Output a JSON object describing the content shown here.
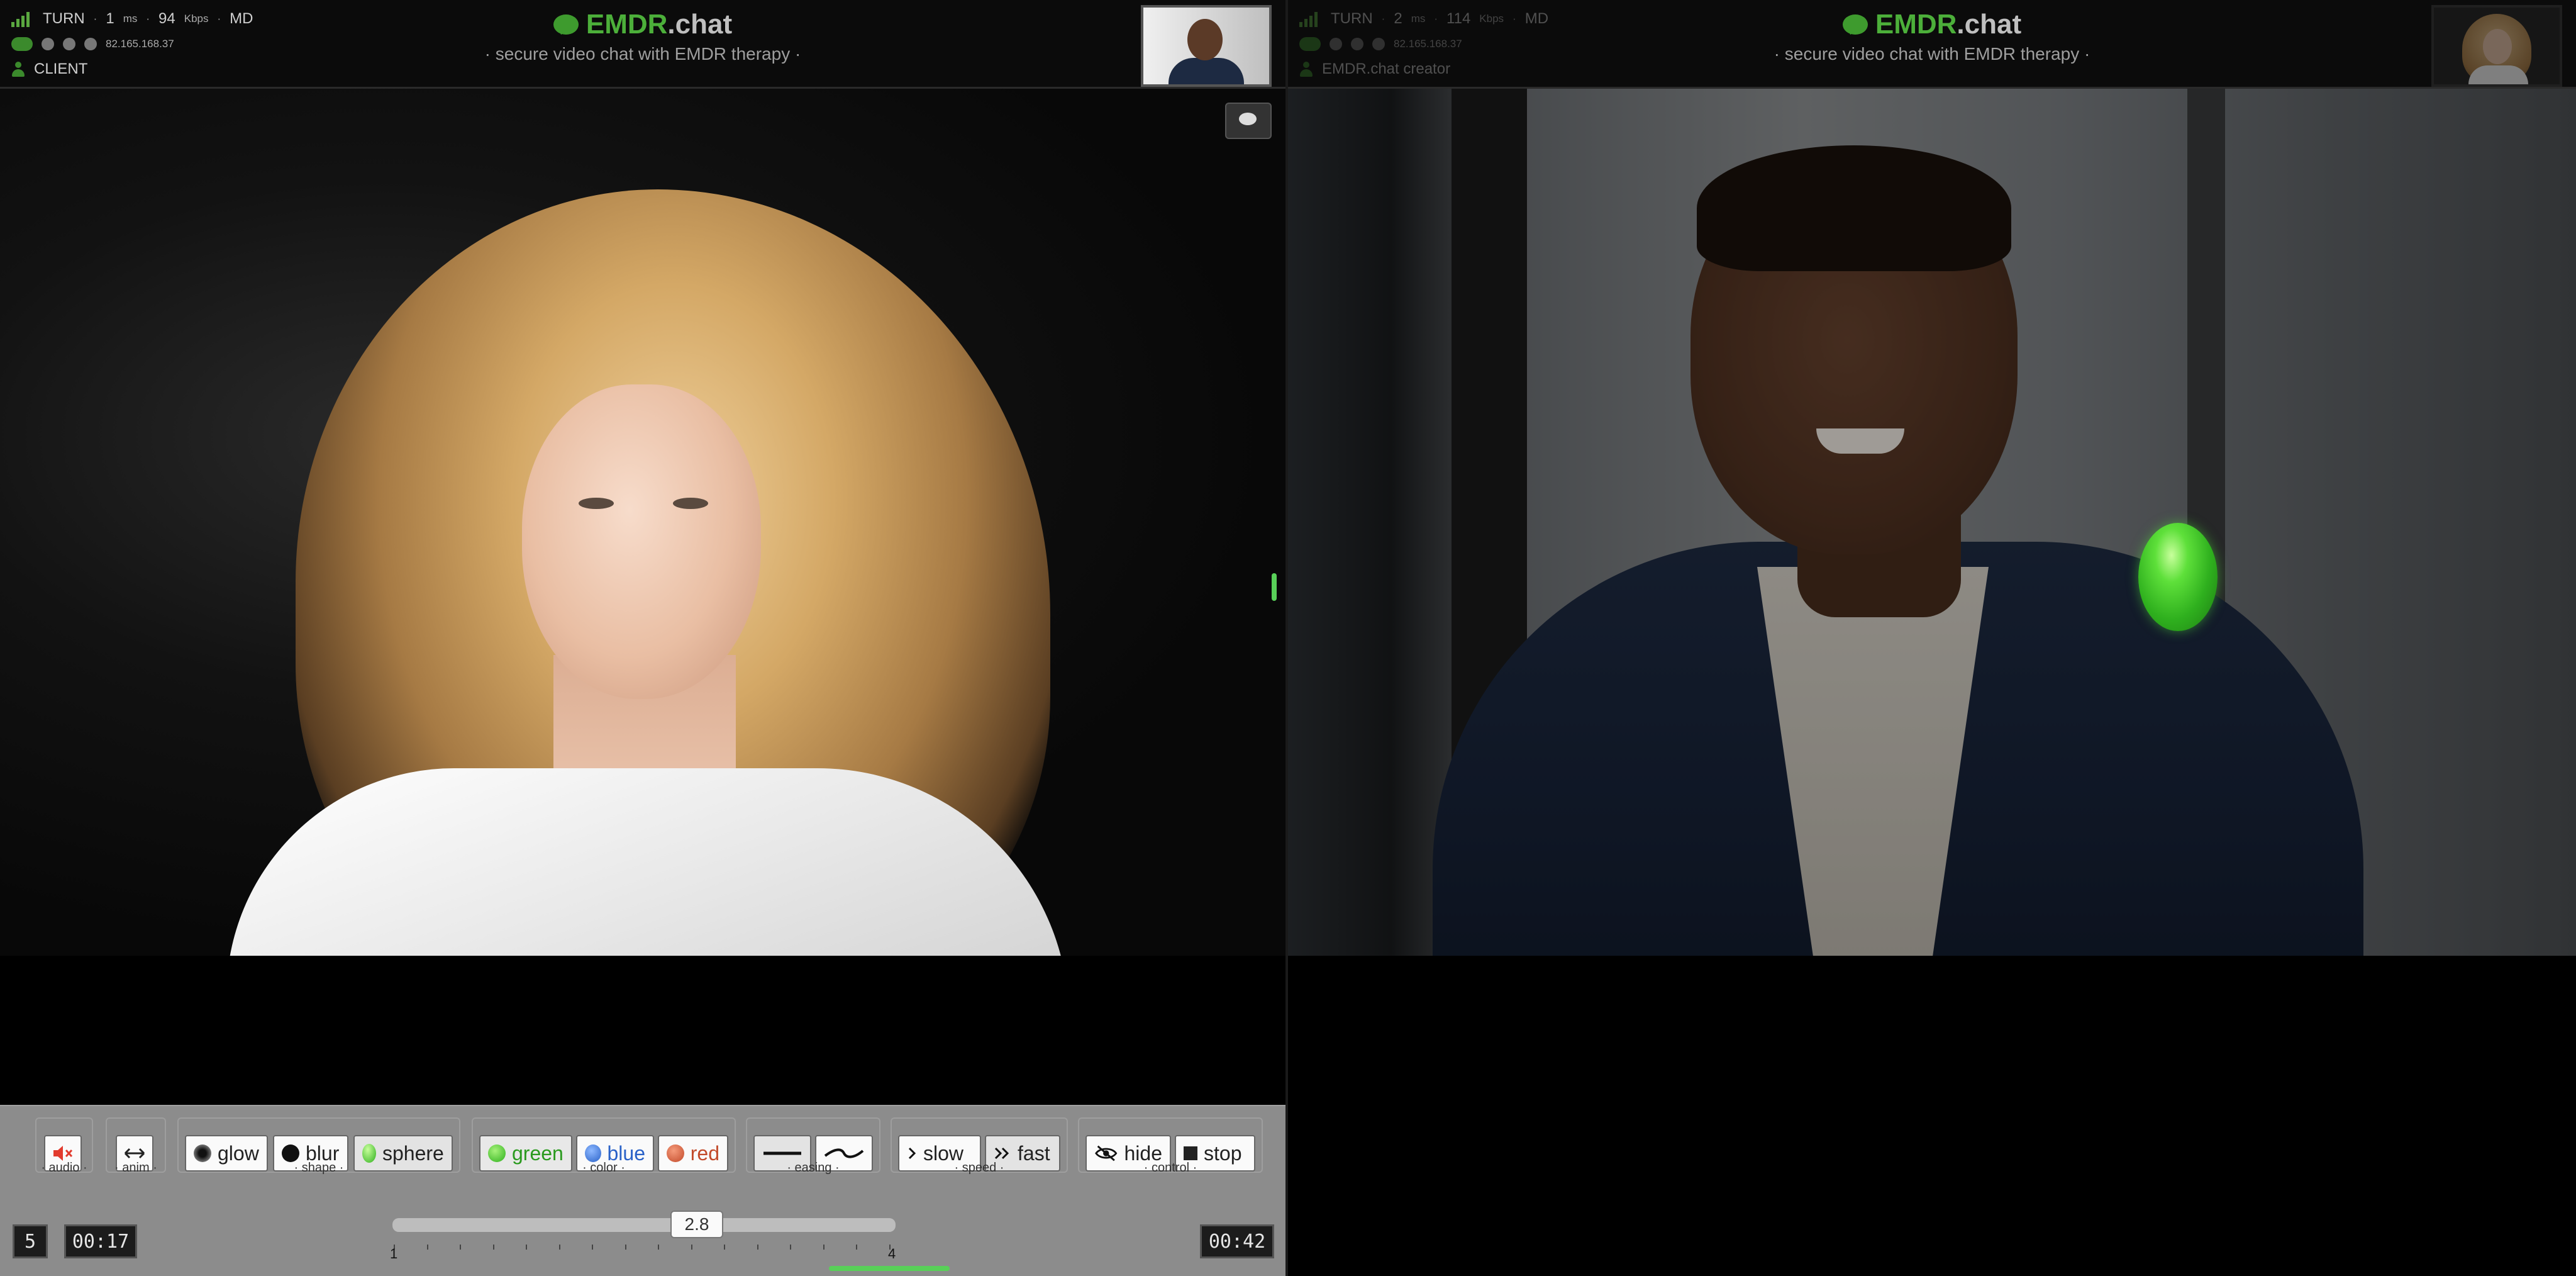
{
  "brand": {
    "name_main": "EMDR",
    "name_tld": ".chat",
    "subtitle": "· secure video chat with EMDR therapy ·"
  },
  "left_status": {
    "connection": "TURN",
    "latency": "1",
    "latency_unit": "ms",
    "bitrate": "94",
    "bitrate_unit": "Kbps",
    "region": "MD",
    "ip": "82.165.168.37",
    "role": "CLIENT"
  },
  "right_status": {
    "connection": "TURN",
    "latency": "2",
    "latency_unit": "ms",
    "bitrate": "114",
    "bitrate_unit": "Kbps",
    "region": "MD",
    "ip": "82.165.168.37",
    "role": "EMDR.chat creator"
  },
  "controls": {
    "audio": {
      "label": "· audio ·"
    },
    "anim": {
      "label": "· anim ·"
    },
    "shape": {
      "label": "· shape ·",
      "glow": "glow",
      "blur": "blur",
      "sphere": "sphere"
    },
    "color": {
      "label": "· color ·",
      "green": "green",
      "blue": "blue",
      "red": "red"
    },
    "easing": {
      "label": "· easing ·"
    },
    "speed": {
      "label": "· speed ·",
      "slow": "slow",
      "fast": "fast"
    },
    "control": {
      "label": "· control ·",
      "hide": "hide",
      "stop": "stop"
    }
  },
  "session": {
    "count": "5",
    "elapsed": "00:17",
    "remaining": "00:42"
  },
  "slider": {
    "value": "2.8",
    "min_label": "1",
    "max_label": "4"
  },
  "colors": {
    "accent_green": "#4caf3a",
    "orb_green": "#2fb01e",
    "color_blue": "#2a62c8",
    "color_red": "#c24a2a"
  },
  "icons": [
    "signal-bars-icon",
    "cloud-icon",
    "person-icon",
    "chat-icon",
    "muted-speaker-icon",
    "left-right-arrow-icon",
    "glow-dot-icon",
    "blur-dot-icon",
    "sphere-icon",
    "line-easing-icon",
    "wave-easing-icon",
    "chevron-right-icon",
    "double-chevron-right-icon",
    "eye-off-icon",
    "stop-square-icon"
  ]
}
